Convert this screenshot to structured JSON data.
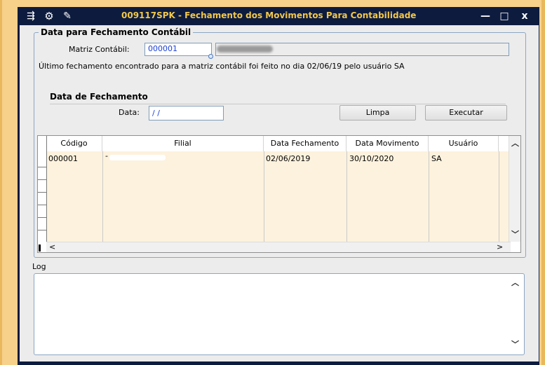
{
  "window": {
    "title": "009117SPK - Fechamento dos Movimentos Para Contabilidade",
    "controls": {
      "minimize": "—",
      "maximize": "□",
      "close": "x"
    }
  },
  "group": {
    "legend": "Data para Fechamento Contábil",
    "matriz_label": "Matriz Contábil:",
    "matriz_value": "000001",
    "info_text": "Último fechamento encontrado para a matriz contábil foi feito no dia 02/06/19 pelo usuário SA"
  },
  "fechamento": {
    "title": "Data de Fechamento",
    "data_label": "Data:",
    "data_value": " / /",
    "limpa_label": "Limpa",
    "executar_label": "Executar"
  },
  "grid": {
    "columns": [
      "Código",
      "Filial",
      "Data Fechamento",
      "Data Movimento",
      "Usuário"
    ],
    "rows": [
      {
        "codigo": "000001",
        "filial": "-",
        "data_fechamento": "02/06/2019",
        "data_movimento": "30/10/2020",
        "usuario": "SA"
      }
    ]
  },
  "log": {
    "label": "Log"
  },
  "icons": [
    "window-menu-icon",
    "settings-icon",
    "wrench-icon",
    "lookup-icon",
    "scroll-up-icon",
    "scroll-down-icon",
    "scroll-left-icon",
    "scroll-right-icon"
  ],
  "colors": {
    "title_text": "#f2c84b",
    "titlebar_bg": "#0d1b3e",
    "field_text": "#1a3fd6",
    "row_highlight": "#fdf2dd",
    "outer_bg": "#f7d08a"
  }
}
